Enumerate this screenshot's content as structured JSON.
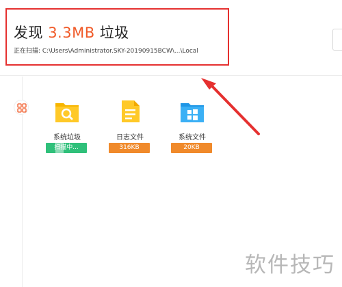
{
  "header": {
    "title_prefix": "发现",
    "junk_size": "3.3MB",
    "title_suffix": "垃圾",
    "scan_status": "正在扫描: C:\\Users\\Administrator.SKY-20190915BCW\\...\\Local"
  },
  "categories": [
    {
      "name": "系统垃圾",
      "status": "扫描中...",
      "icon": "magnifier-folder-icon"
    },
    {
      "name": "日志文件",
      "status": "316KB",
      "icon": "document-icon"
    },
    {
      "name": "系统文件",
      "status": "20KB",
      "icon": "windows-folder-icon"
    }
  ],
  "rail": {
    "icon": "grid-icon"
  },
  "watermark": {
    "text": "软件技巧"
  },
  "colors": {
    "accent_orange": "#f05a28",
    "highlight_red": "#e5302f",
    "status_green": "#2fc07a",
    "status_orange": "#f08a2b"
  }
}
